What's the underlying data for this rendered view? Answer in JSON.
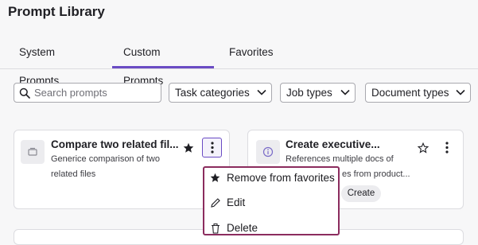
{
  "page": {
    "title": "Prompt Library"
  },
  "tabs": [
    {
      "label": "System Prompts",
      "active": false
    },
    {
      "label": "Custom Prompts",
      "active": true
    },
    {
      "label": "Favorites",
      "active": false
    }
  ],
  "search": {
    "placeholder": "Search prompts",
    "value": ""
  },
  "filters": [
    {
      "label": "Task categories"
    },
    {
      "label": "Job types"
    },
    {
      "label": "Document types"
    }
  ],
  "cards": [
    {
      "title": "Compare two related fil...",
      "description": "Genericе comparison of two related files",
      "favorite": true
    },
    {
      "title": "Create executive...",
      "description_line1": "References multiple docs of",
      "description_line2": "es from product...",
      "favorite": false,
      "action_label": "Create"
    }
  ],
  "menu": {
    "items": [
      {
        "label": "Remove from favorites",
        "icon": "star-icon"
      },
      {
        "label": "Edit",
        "icon": "pencil-icon"
      },
      {
        "label": "Delete",
        "icon": "trash-icon"
      }
    ]
  },
  "colors": {
    "accent": "#6a4bc4",
    "menu_border": "#8b2c5e"
  }
}
